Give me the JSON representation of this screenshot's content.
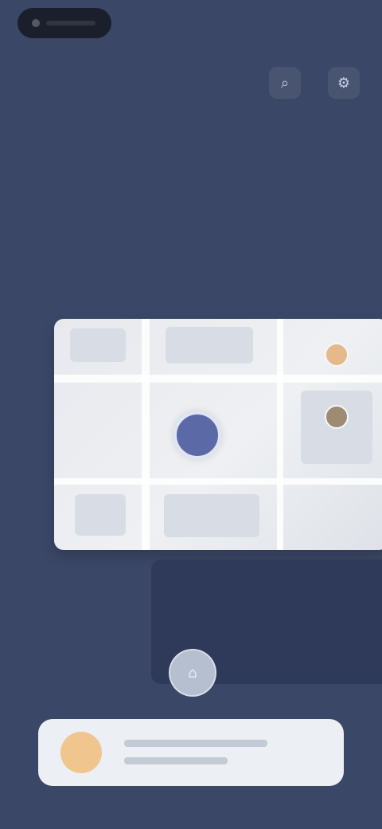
{
  "header": {
    "title": "",
    "subtitle": ""
  },
  "top_actions": [
    {
      "icon": "search-icon",
      "glyph": "⌕"
    },
    {
      "icon": "settings-icon",
      "glyph": "⚙"
    }
  ],
  "status": {},
  "map": {},
  "home_button": {
    "icon": "home-icon",
    "glyph": "⌂"
  },
  "bottom_card": {
    "title": "",
    "subtitle": ""
  },
  "colors": {
    "background": "#3b4766",
    "map": "#e7e9ee",
    "marker": "#5b6aa6",
    "avatar": "#f0c58e"
  }
}
